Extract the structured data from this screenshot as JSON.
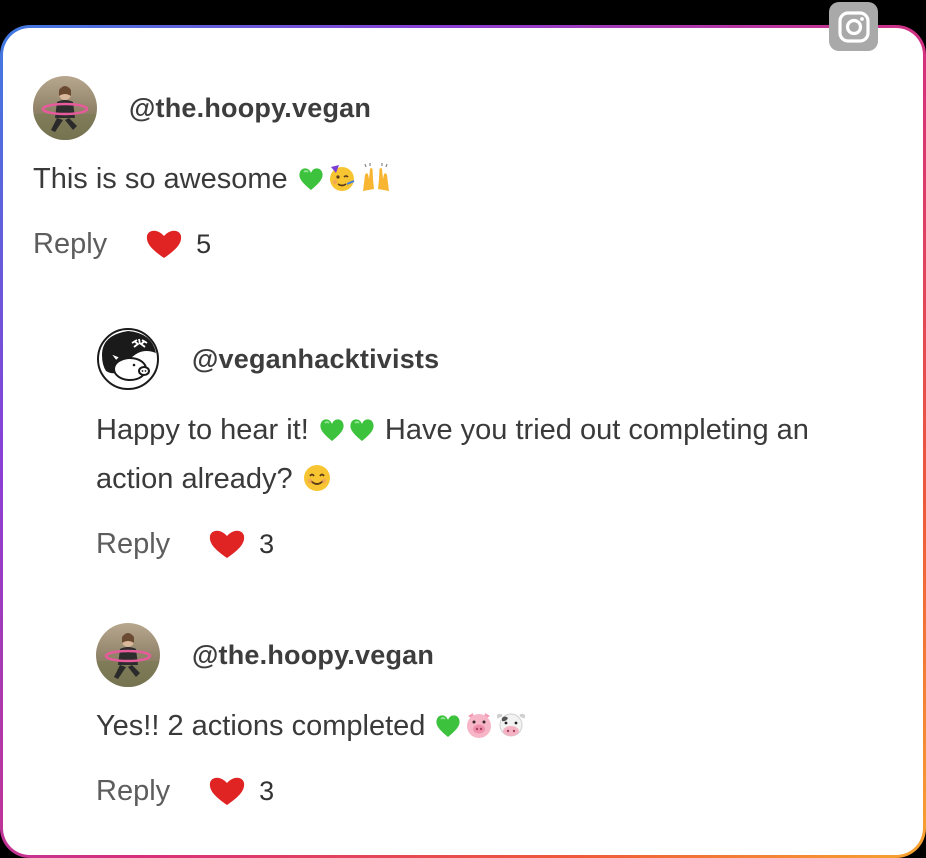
{
  "colors": {
    "heart": "#e02424",
    "emerald_heart": "#3cc23c",
    "badge": "#a9a9a9"
  },
  "icons": {
    "badge": "instagram-icon",
    "like": "heart-icon"
  },
  "comments": [
    {
      "handle": "@the.hoopy.vegan",
      "avatar": "hula-hoop-photo-avatar",
      "text": "This is so awesome",
      "emojis": [
        "green-heart",
        "partying-face",
        "raising-hands"
      ],
      "reply_label": "Reply",
      "likes": "5"
    },
    {
      "handle": "@veganhacktivists",
      "avatar": "pig-logo-avatar",
      "text_1": "Happy to hear it!",
      "text_2": "Have you tried out completing an",
      "text_3": "action already?",
      "emojis": [
        "green-heart",
        "green-heart",
        "smiling-face"
      ],
      "reply_label": "Reply",
      "likes": "3"
    },
    {
      "handle": "@the.hoopy.vegan",
      "avatar": "hula-hoop-photo-avatar",
      "text": "Yes!! 2 actions completed",
      "emojis": [
        "green-heart",
        "pig-face",
        "cow-face"
      ],
      "reply_label": "Reply",
      "likes": "3"
    }
  ]
}
